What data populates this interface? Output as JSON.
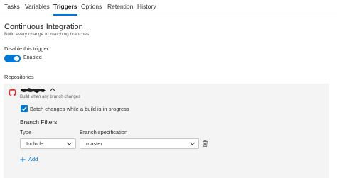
{
  "tabs": [
    {
      "label": "Tasks"
    },
    {
      "label": "Variables"
    },
    {
      "label": "Triggers"
    },
    {
      "label": "Options"
    },
    {
      "label": "Retention"
    },
    {
      "label": "History"
    }
  ],
  "active_tab": "Triggers",
  "ci": {
    "title": "Continuous Integration",
    "subtitle": "Build every change to matching branches"
  },
  "disable_trigger": {
    "label": "Disable this trigger",
    "toggle_state": "Enabled"
  },
  "repositories": {
    "label": "Repositories",
    "repo_subtitle": "Build when any branch changes",
    "batch_label": "Batch changes while a build is in progress",
    "batch_checked": true
  },
  "branch_filters": {
    "title": "Branch Filters",
    "type_label": "Type",
    "spec_label": "Branch specification",
    "type_value": "Include",
    "spec_value": "master",
    "add_label": "Add"
  },
  "colors": {
    "accent": "#0078d4",
    "github_icon": "#d13438",
    "panel": "#f4f4f4"
  },
  "icons": [
    "github-icon",
    "chevron-up-icon",
    "checkmark-icon",
    "chevron-down-icon",
    "trash-icon",
    "plus-icon"
  ]
}
